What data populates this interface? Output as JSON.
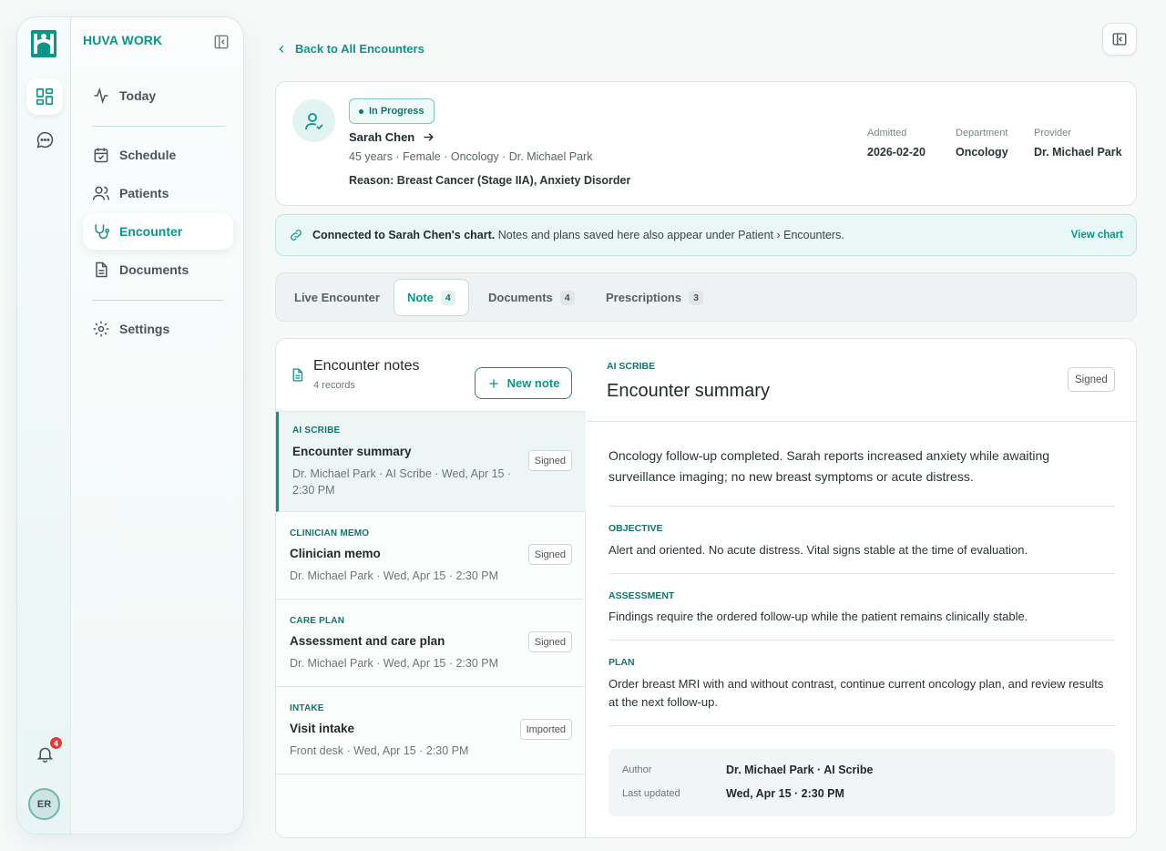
{
  "app": {
    "brand": "HUVA WORK"
  },
  "sidebar": {
    "items": [
      {
        "label": "Today",
        "icon": "activity-icon"
      },
      {
        "label": "Schedule",
        "icon": "calendar-check-icon"
      },
      {
        "label": "Patients",
        "icon": "users-icon"
      },
      {
        "label": "Encounter",
        "icon": "stethoscope-icon",
        "active": true
      },
      {
        "label": "Documents",
        "icon": "document-icon"
      },
      {
        "label": "Settings",
        "icon": "gear-icon"
      }
    ],
    "notifications_count": "4",
    "avatar_initials": "ER"
  },
  "header": {
    "back_label": "Back to All Encounters"
  },
  "patient": {
    "status": "In Progress",
    "name": "Sarah Chen",
    "meta": "45 years · Female · Oncology · Dr. Michael Park",
    "reason": "Reason: Breast Cancer (Stage IIA), Anxiety Disorder",
    "stats": [
      {
        "label": "Admitted",
        "value": "2026-02-20"
      },
      {
        "label": "Department",
        "value": "Oncology"
      },
      {
        "label": "Provider",
        "value": "Dr. Michael Park"
      }
    ]
  },
  "banner": {
    "bold": "Connected to Sarah Chen's chart.",
    "text": "Notes and plans saved here also appear under Patient › Encounters.",
    "link": "View chart"
  },
  "tabs": [
    {
      "label": "Live Encounter",
      "count": ""
    },
    {
      "label": "Note",
      "count": "4",
      "active": true
    },
    {
      "label": "Documents",
      "count": "4"
    },
    {
      "label": "Prescriptions",
      "count": "3"
    }
  ],
  "notes": {
    "title": "Encounter notes",
    "count_label": "4 records",
    "new_label": "New note",
    "items": [
      {
        "type": "AI SCRIBE",
        "title": "Encounter summary",
        "meta": "Dr. Michael Park · AI Scribe · Wed, Apr 15 · 2:30 PM",
        "badge": "Signed"
      },
      {
        "type": "CLINICIAN MEMO",
        "title": "Clinician memo",
        "meta": "Dr. Michael Park · Wed, Apr 15 · 2:30 PM",
        "badge": "Signed"
      },
      {
        "type": "CARE PLAN",
        "title": "Assessment and care plan",
        "meta": "Dr. Michael Park · Wed, Apr 15 · 2:30 PM",
        "badge": "Signed"
      },
      {
        "type": "INTAKE",
        "title": "Visit intake",
        "meta": "Front desk · Wed, Apr 15 · 2:30 PM",
        "badge": "Imported"
      }
    ]
  },
  "detail": {
    "type": "AI SCRIBE",
    "title": "Encounter summary",
    "badge": "Signed",
    "summary": "Oncology follow-up completed. Sarah reports increased anxiety while awaiting surveillance imaging; no new breast symptoms or acute distress.",
    "sections": [
      {
        "title": "OBJECTIVE",
        "text": "Alert and oriented. No acute distress. Vital signs stable at the time of evaluation."
      },
      {
        "title": "ASSESSMENT",
        "text": "Findings require the ordered follow-up while the patient remains clinically stable."
      },
      {
        "title": "PLAN",
        "text": "Order breast MRI with and without contrast, continue current oncology plan, and review results at the next follow-up."
      }
    ],
    "author_label": "Author",
    "author": "Dr. Michael Park · AI Scribe",
    "updated_label": "Last updated",
    "updated": "Wed, Apr 15 · 2:30 PM"
  }
}
